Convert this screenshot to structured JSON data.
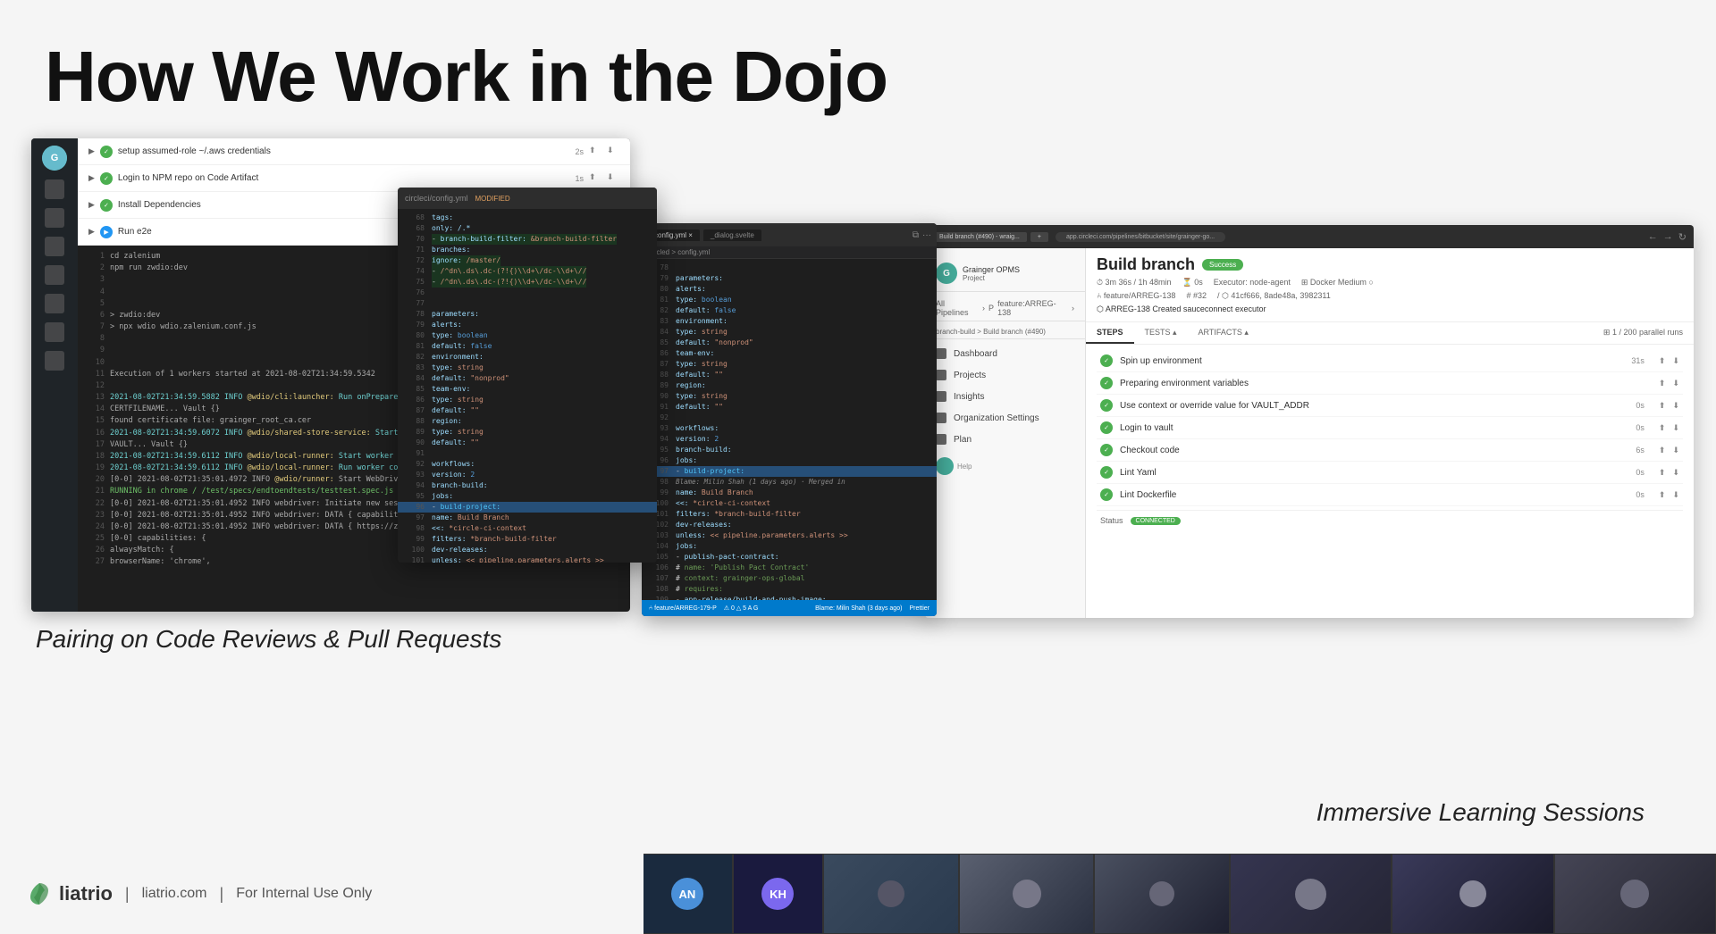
{
  "page": {
    "title": "How We Work in the Dojo",
    "background_color": "#f5f5f5"
  },
  "header": {
    "title": "How We Work in the Dojo"
  },
  "left_panel": {
    "label": "Pairing on Code Reviews & Pull Requests",
    "steps": [
      {
        "id": 1,
        "text": "setup assumed-role ~/.aws credentials",
        "time": "2s",
        "status": "success"
      },
      {
        "id": 2,
        "text": "Login to NPM repo on Code Artifact",
        "time": "1s",
        "status": "success"
      },
      {
        "id": 3,
        "text": "Install Dependencies",
        "status": "success"
      },
      {
        "id": 4,
        "text": "Run e2e",
        "status": "running"
      }
    ],
    "log_lines": [
      {
        "num": "1",
        "text": "cd zalenium"
      },
      {
        "num": "2",
        "text": "npm run zwdio:dev"
      },
      {
        "num": "6",
        "text": "$ zwdio:dev"
      },
      {
        "num": "7",
        "text": "$ npx wdio wdio.zalenium.conf.js"
      },
      {
        "num": "10",
        "text": ""
      },
      {
        "num": "11",
        "text": "Execution of 1 workers started at 2021-08-02T21:34:59.5342"
      },
      {
        "num": "13",
        "text": "2021-08-02T21:34:59.5882 INFO @wdio/cli:launcher: Run onPrepare hook"
      }
    ]
  },
  "middle_panel": {
    "filename": "circleci/config.yml",
    "modified": true,
    "tab_label": "config.yml MODIFIED"
  },
  "center_vscode": {
    "tabs": [
      "config.yml ×",
      "_dialog.svelte"
    ],
    "breadcrumb": "circled > config.yml",
    "title": "config.yml"
  },
  "right_panel": {
    "title": "Build branch",
    "job": "Build branch (#490)",
    "status": "Success",
    "branch": "feature/ARREG-138",
    "pr": "#32",
    "commit": "41cf666, 8ade48a, 3982311",
    "message": "ARREG-138 Created sauceconnect executor",
    "duration": "3m 36s",
    "tabs": [
      "STEPS",
      "TESTS ▴",
      "ARTIFACTS ▴"
    ],
    "steps": [
      {
        "label": "Spin up environment",
        "time": "31s",
        "status": "success"
      },
      {
        "label": "Preparing environment variables",
        "time": "",
        "status": "success"
      },
      {
        "label": "Use context or override value for VAULT_ADDR",
        "time": "0s",
        "status": "success"
      },
      {
        "label": "Login to vault",
        "time": "0s",
        "status": "success"
      },
      {
        "label": "Checkout code",
        "time": "6s",
        "status": "success"
      },
      {
        "label": "Lint Yaml",
        "time": "0s",
        "status": "success"
      },
      {
        "label": "Lint Dockerfile",
        "time": "0s",
        "status": "success"
      }
    ],
    "nav_items": [
      "Dashboard",
      "Projects",
      "Insights",
      "Organization Settings",
      "Plan"
    ]
  },
  "bottom_label": {
    "text": "Immersive Learning Sessions"
  },
  "footer": {
    "logo_text": "liatrio",
    "website": "liatrio.com",
    "legal": "For Internal Use Only",
    "separator": "|"
  },
  "colors": {
    "success_green": "#4caf50",
    "running_blue": "#2196f3",
    "accent": "#0078d4",
    "dark_bg": "#1e1e1e",
    "sidebar_bg": "#24292e"
  },
  "video_participants": [
    {
      "initials": "AN",
      "color": "#4a90d9"
    },
    {
      "initials": "KH",
      "color": "#7b68ee"
    },
    {
      "initials": "",
      "color": "#555"
    },
    {
      "initials": "",
      "color": "#444"
    },
    {
      "initials": "",
      "color": "#3a3a5c"
    },
    {
      "initials": "",
      "color": "#3a3a5c"
    },
    {
      "initials": "",
      "color": "#3a3a5c"
    },
    {
      "initials": "",
      "color": "#3a3a5c"
    }
  ]
}
